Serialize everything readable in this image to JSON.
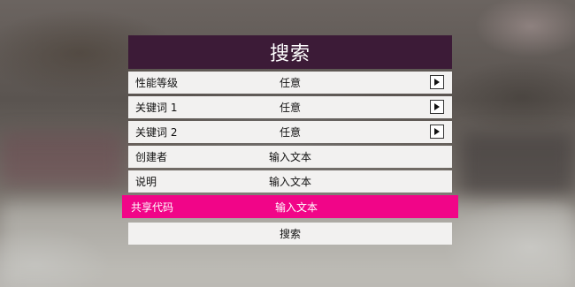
{
  "dialog": {
    "title": "搜索",
    "rows": [
      {
        "label": "性能等级",
        "value": "任意",
        "has_arrow": true
      },
      {
        "label": "关键词 1",
        "value": "任意",
        "has_arrow": true
      },
      {
        "label": "关键词 2",
        "value": "任意",
        "has_arrow": true
      },
      {
        "label": "创建者",
        "value": "输入文本",
        "has_arrow": false
      },
      {
        "label": "说明",
        "value": "输入文本",
        "has_arrow": false
      },
      {
        "label": "共享代码",
        "value": "输入文本",
        "has_arrow": false,
        "selected": true
      }
    ],
    "search_button": "搜索"
  },
  "colors": {
    "title_bg": "#3c1b37",
    "row_bg": "#f2f1f0",
    "selected_bg": "#f10588"
  },
  "icons": {
    "row_arrow": "play-arrow-icon"
  }
}
